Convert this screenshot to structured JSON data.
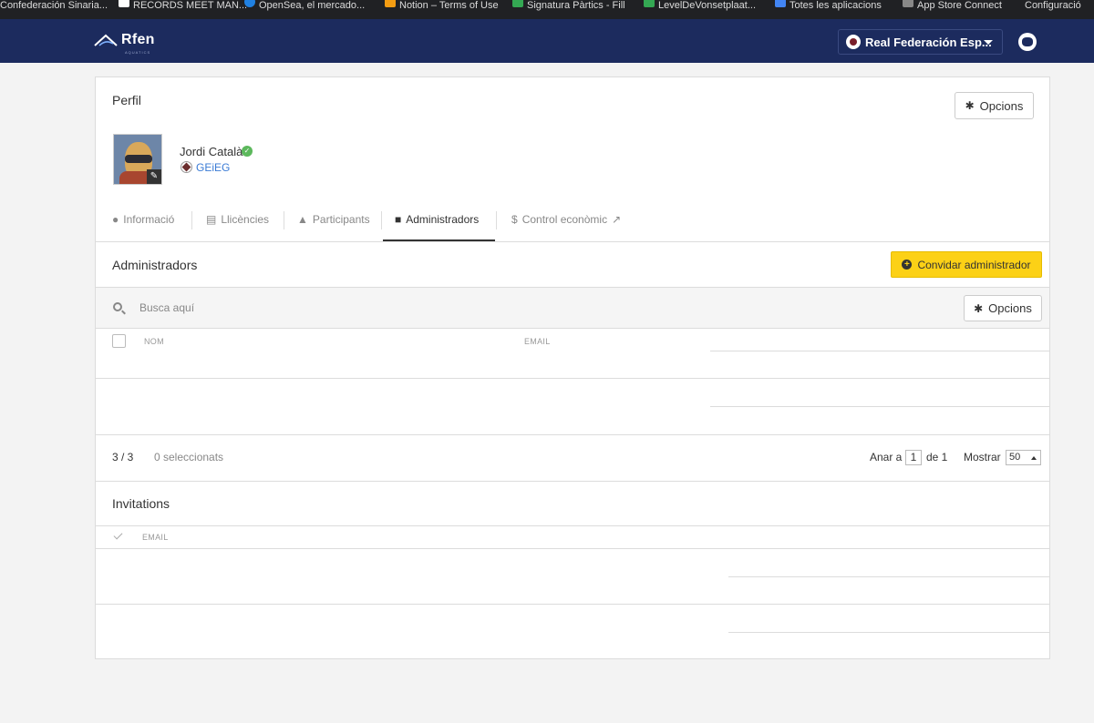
{
  "browser": {
    "bookmarks": [
      {
        "label": "Confederación Sinaria...",
        "color": "#c0392b"
      },
      {
        "label": "RECORDS MEET MAN...",
        "color": "#ffffff"
      },
      {
        "label": "OpenSea, el mercado...",
        "color": "#2081e2"
      },
      {
        "label": "Notion – Terms of Use",
        "color": "#f39c12"
      },
      {
        "label": "Signatura Pàrtics - Fill",
        "color": "#34a853"
      },
      {
        "label": "LevelDeVonsetplaat...",
        "color": "#34a853"
      },
      {
        "label": "Totes les aplicacions",
        "color": "#4285f4"
      },
      {
        "label": "App Store Connect",
        "color": "#888888"
      },
      {
        "label": "Configuració",
        "color": "#888888"
      }
    ]
  },
  "nav": {
    "logo_text": "Rfen",
    "logo_sub": "AQUATICS",
    "org_name": "Real Federación Esp...",
    "colors": {
      "navbar": "#1c2b5e",
      "accent": "#fcd116"
    }
  },
  "profile": {
    "title": "Perfil",
    "options_label": "Opcions",
    "user_name": "Jordi Català",
    "club": "GEiEG"
  },
  "tabs": [
    {
      "label": "Informació",
      "icon": "info-icon",
      "active": false
    },
    {
      "label": "Llicències",
      "icon": "id-card-icon",
      "active": false
    },
    {
      "label": "Participants",
      "icon": "thumbs-up-icon",
      "active": false
    },
    {
      "label": "Administradors",
      "icon": "briefcase-icon",
      "active": true
    },
    {
      "label": "Control econòmic",
      "icon": "dollar-icon",
      "active": false
    }
  ],
  "admins": {
    "title": "Administradors",
    "invite_label": "Convidar administrador",
    "search_placeholder": "Busca aquí",
    "options_label": "Opcions",
    "columns": [
      "NOM",
      "EMAIL"
    ],
    "count": "3 / 3",
    "selected": "0 seleccionats",
    "goto_label": "Anar a",
    "page": "1",
    "page_of": "de 1",
    "show_label": "Mostrar",
    "per_page": "50"
  },
  "invitations": {
    "title": "Invitations",
    "columns": [
      "EMAIL"
    ]
  }
}
